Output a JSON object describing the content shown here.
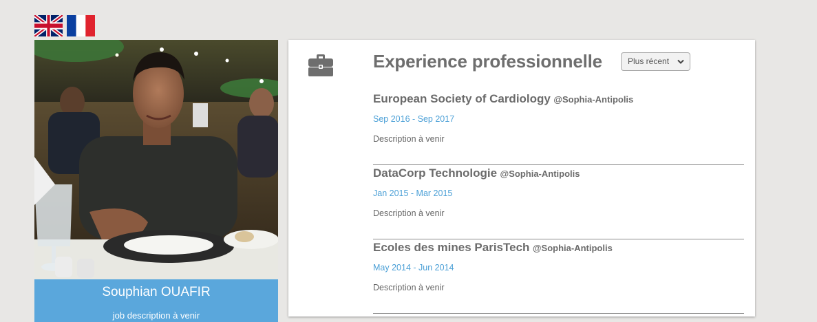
{
  "languages": [
    {
      "code": "en",
      "label": "English"
    },
    {
      "code": "fr",
      "label": "Français"
    }
  ],
  "profile": {
    "name": "Souphian OUAFIR",
    "description": "job description à venir"
  },
  "experience": {
    "icon": "briefcase-icon",
    "title": "Experience professionnelle",
    "sort": {
      "selected": "Plus récent"
    },
    "items": [
      {
        "company": "European Society of Cardiology",
        "location": "@Sophia-Antipolis",
        "dates": "Sep 2016 - Sep 2017",
        "description": "Description à venir"
      },
      {
        "company": "DataCorp Technologie",
        "location": "@Sophia-Antipolis",
        "dates": "Jan 2015 - Mar 2015",
        "description": "Description à venir"
      },
      {
        "company": "Ecoles des mines ParisTech",
        "location": "@Sophia-Antipolis",
        "dates": "May 2014 - Jun 2014",
        "description": "Description à venir"
      }
    ]
  },
  "colors": {
    "accent": "#5aa7dc",
    "dates": "#4a9fd6",
    "title": "#6e6e6e",
    "background": "#e8e7e5"
  }
}
